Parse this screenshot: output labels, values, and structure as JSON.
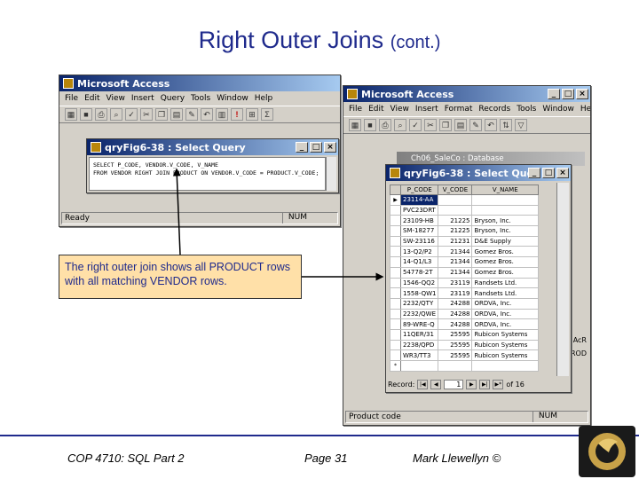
{
  "slide": {
    "title": "Right Outer Joins",
    "title_suffix": "(cont.)",
    "callout": "The right outer join shows all PRODUCT rows with all matching VENDOR rows.",
    "footer": {
      "course": "COP 4710: SQL Part 2",
      "page": "Page 31",
      "author": "Mark Llewellyn ©"
    }
  },
  "back_window": {
    "title": "Microsoft Access",
    "menu": [
      "File",
      "Edit",
      "View",
      "Insert",
      "Query",
      "Tools",
      "Window",
      "Help"
    ],
    "status": "Ready",
    "num": "NUM",
    "query_window": {
      "title": "qryFig6-38 : Select Query",
      "sql": "SELECT P_CODE, VENDOR.V_CODE, V_NAME\nFROM VENDOR RIGHT JOIN PRODUCT ON VENDOR.V_CODE = PRODUCT.V_CODE;"
    }
  },
  "front_window": {
    "title": "Microsoft Access",
    "menu": [
      "File",
      "Edit",
      "View",
      "Insert",
      "Format",
      "Records",
      "Tools",
      "Window",
      "Help"
    ],
    "database_title": "Ch06_SaleCo : Database",
    "status": "Product code",
    "num": "NUM",
    "side_fragments": [
      "AcR",
      "ROD"
    ],
    "query_window": {
      "title": "qryFig6-38 : Select Query",
      "columns": [
        "P_CODE",
        "V_CODE",
        "V_NAME"
      ],
      "rows": [
        [
          "23114-AA",
          "",
          ""
        ],
        [
          "PVC23DRT",
          "",
          ""
        ],
        [
          "23109-HB",
          "21225",
          "Bryson, Inc."
        ],
        [
          "SM-18277",
          "21225",
          "Bryson, Inc."
        ],
        [
          "SW-23116",
          "21231",
          "D&E Supply"
        ],
        [
          "13-Q2/P2",
          "21344",
          "Gomez Bros."
        ],
        [
          "14-Q1/L3",
          "21344",
          "Gomez Bros."
        ],
        [
          "54778-2T",
          "21344",
          "Gomez Bros."
        ],
        [
          "1546-QQ2",
          "23119",
          "Randsets Ltd."
        ],
        [
          "1558-QW1",
          "23119",
          "Randsets Ltd."
        ],
        [
          "2232/QTY",
          "24288",
          "ORDVA, Inc."
        ],
        [
          "2232/QWE",
          "24288",
          "ORDVA, Inc."
        ],
        [
          "89-WRE-Q",
          "24288",
          "ORDVA, Inc."
        ],
        [
          "11QER/31",
          "25595",
          "Rubicon Systems"
        ],
        [
          "2238/QPD",
          "25595",
          "Rubicon Systems"
        ],
        [
          "WR3/TT3",
          "25595",
          "Rubicon Systems"
        ],
        [
          "",
          "",
          ""
        ]
      ],
      "record_label": "Record:",
      "record_current": "1",
      "record_total": "of 16"
    }
  }
}
